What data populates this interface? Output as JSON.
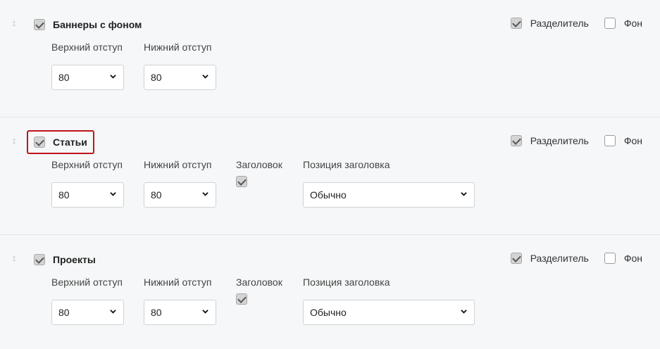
{
  "labels": {
    "top_padding": "Верхний отступ",
    "bottom_padding": "Нижний отступ",
    "heading": "Заголовок",
    "heading_position": "Позиция заголовка",
    "divider": "Разделитель",
    "background": "Фон"
  },
  "sections": [
    {
      "title": "Баннеры с фоном",
      "enabled": true,
      "highlighted": false,
      "divider": true,
      "background": false,
      "top_padding": "80",
      "bottom_padding": "80",
      "has_heading": false
    },
    {
      "title": "Статьи",
      "enabled": true,
      "highlighted": true,
      "divider": true,
      "background": false,
      "top_padding": "80",
      "bottom_padding": "80",
      "has_heading": true,
      "heading": true,
      "heading_position": "Обычно"
    },
    {
      "title": "Проекты",
      "enabled": true,
      "highlighted": false,
      "divider": true,
      "background": false,
      "top_padding": "80",
      "bottom_padding": "80",
      "has_heading": true,
      "heading": true,
      "heading_position": "Обычно"
    }
  ],
  "icons": {
    "drag": "drag-handle-icon",
    "chevron": "chevron-down-icon",
    "check": "checkmark-icon"
  },
  "colors": {
    "background": "#f5f7f8",
    "highlight_border": "#c0141b",
    "checkbox_checked": "#d4d4d4"
  }
}
